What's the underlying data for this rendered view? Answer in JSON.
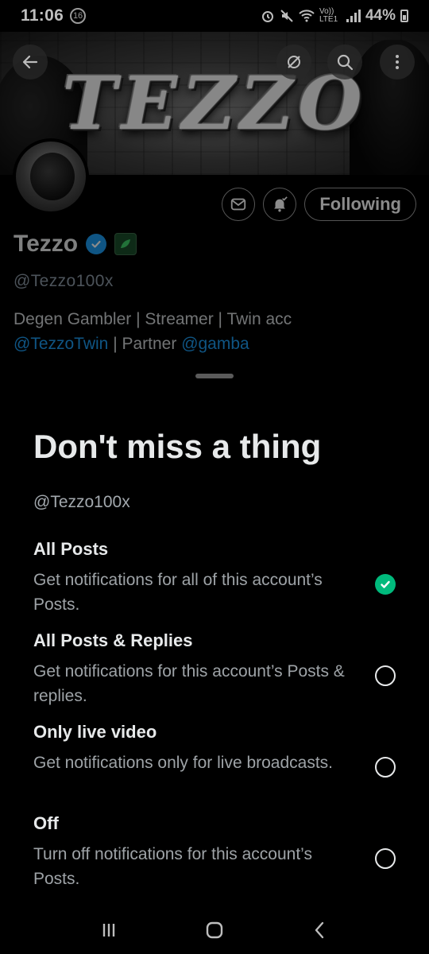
{
  "status_bar": {
    "time": "11:06",
    "notification_count": "16",
    "network_label": "Vo)) LTE1",
    "battery": "44%"
  },
  "banner": {
    "title": "TEZZO"
  },
  "profile": {
    "name": "Tezzo",
    "handle": "@Tezzo100x",
    "following_label": "Following",
    "bio": {
      "line1": "Degen Gambler | Streamer | Twin acc",
      "link1": "@TezzoTwin",
      "middle": " | Partner ",
      "link2": "@gamba"
    }
  },
  "sheet": {
    "title": "Don't miss a thing",
    "handle": "@Tezzo100x",
    "options": [
      {
        "title": "All Posts",
        "description": "Get notifications for all of this account’s Posts.",
        "selected": true
      },
      {
        "title": "All Posts & Replies",
        "description": "Get notifications for this account’s Posts & replies.",
        "selected": false
      },
      {
        "title": "Only live video",
        "description": "Get notifications only for live broadcasts.",
        "selected": false
      },
      {
        "title": "Off",
        "description": "Turn off notifications for this account’s Posts.",
        "selected": false
      }
    ]
  },
  "colors": {
    "accent_blue": "#1d9bf0",
    "selected_green": "#00ba7c",
    "background": "#000000"
  },
  "icons": {
    "back": "arrow-left-icon",
    "grok": "grok-icon",
    "search": "search-icon",
    "more": "more-vertical-icon",
    "message": "envelope-icon",
    "notify": "bell-check-icon",
    "nav_recents": "recents-icon",
    "nav_home": "home-icon",
    "nav_back": "back-chevron-icon"
  }
}
